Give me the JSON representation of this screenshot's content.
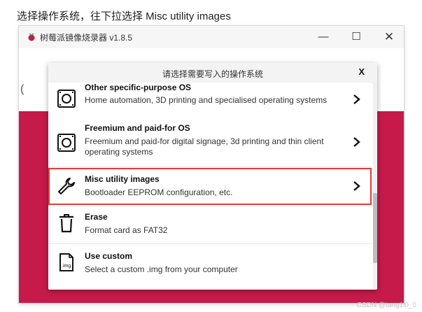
{
  "caption": "选择操作系统，往下拉选择 Misc utility images",
  "window": {
    "title": "树莓派镜像烧录器 v1.8.5",
    "minimize": "—",
    "maximize": "☐",
    "close": "✕",
    "background_colors": {
      "top": "#ffffff",
      "bottom": "#c51a4a"
    },
    "behind_text": "("
  },
  "dialog": {
    "title": "请选择需要写入的操作系统",
    "close_label": "X",
    "items": [
      {
        "name": "Other specific-purpose OS",
        "description": "Home automation, 3D printing and specialised operating systems",
        "icon": "sd-card-icon",
        "has_chevron": true
      },
      {
        "name": "Freemium and paid-for OS",
        "description": "Freemium and paid-for digital signage, 3d printing and thin client operating systems",
        "icon": "sd-card-icon",
        "has_chevron": true
      },
      {
        "name": "Misc utility images",
        "description": "Bootloader EEPROM configuration, etc.",
        "icon": "wrench-icon",
        "has_chevron": true,
        "highlighted": true
      },
      {
        "name": "Erase",
        "description": "Format card as FAT32",
        "icon": "trash-icon",
        "has_chevron": false
      },
      {
        "name": "Use custom",
        "description": "Select a custom .img from your computer",
        "icon": "img-file-icon",
        "icon_text": ".img",
        "has_chevron": false
      }
    ]
  },
  "watermark": "CSDN @tang1l0_0",
  "accent_colors": {
    "brand": "#c51a4a",
    "highlight": "#e03b3b"
  }
}
